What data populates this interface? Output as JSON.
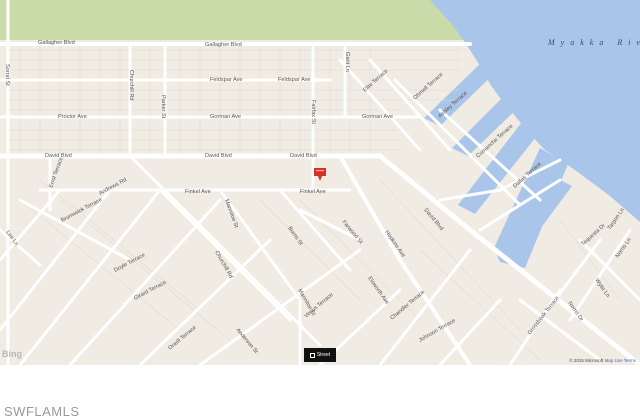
{
  "water": {
    "name": "Myakka River"
  },
  "streets": [
    "Gallagher Blvd",
    "Gallagher Blvd",
    "Feldspar Ave",
    "Feldspar Ave",
    "Gorman Ave",
    "Gorman Ave",
    "Proctor Ave",
    "David Blvd",
    "David Blvd",
    "David Blvd",
    "Finkel Ave",
    "Finkel Ave",
    "Sorrel St",
    "Churchill Rd",
    "Parker St",
    "Fairfax St",
    "Gant Ln",
    "Elite Terrace",
    "Ohmell Terrace",
    "Ashley Terrace",
    "Comanche Terrace",
    "Dallas Terrace",
    "Errol Terrace",
    "Andrews Rd",
    "Brunswick Terrace",
    "Doyle Terrace",
    "Girard Terrace",
    "Mannitoe St",
    "Burns St",
    "Farwood St",
    "Hopkins Ave",
    "Elsworth Ave",
    "Churchill Rd",
    "Mannitoe St",
    "Venus Terrace",
    "Chandler Terrace",
    "Johnson Terrace",
    "Anderson St",
    "Oneill Terrace",
    "Grossbeak Terrace",
    "Norris Dr",
    "Wylie Ln",
    "Norris Ln",
    "Tequesta Dr",
    "Tarpon Ln",
    "David Blvd",
    "Lee Ln"
  ],
  "marker": {
    "icon": "map-pin-icon",
    "color": "#d93025"
  },
  "view_button": {
    "label": "Street",
    "icon": "streetside-icon"
  },
  "attribution": {
    "copyright": "© 2015 Microsoft",
    "link": "Map Use Terms"
  },
  "provider_logo": "Bing",
  "footer": {
    "text": "SWFLAMLS"
  },
  "colors": {
    "land": "#f0ebe3",
    "road": "#ffffff",
    "water": "#a9c5ea",
    "park": "#c9dba9",
    "block_outline": "#e2dcd1"
  }
}
